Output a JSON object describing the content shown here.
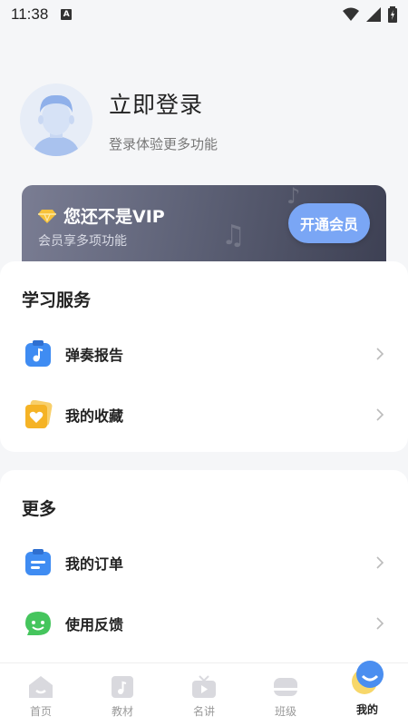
{
  "status_bar": {
    "time": "11:38",
    "indicator": "A"
  },
  "profile": {
    "title": "立即登录",
    "subtitle": "登录体验更多功能"
  },
  "vip": {
    "title": "您还不是VIP",
    "subtitle": "会员享多项功能",
    "button": "开通会员"
  },
  "study_section": {
    "title": "学习服务",
    "items": [
      {
        "label": "弹奏报告",
        "icon": "report-icon"
      },
      {
        "label": "我的收藏",
        "icon": "favorite-icon"
      }
    ]
  },
  "more_section": {
    "title": "更多",
    "items": [
      {
        "label": "我的订单",
        "icon": "order-icon"
      },
      {
        "label": "使用反馈",
        "icon": "feedback-icon"
      }
    ]
  },
  "bottom_nav": {
    "items": [
      {
        "label": "首页"
      },
      {
        "label": "教材"
      },
      {
        "label": "名讲"
      },
      {
        "label": "班级"
      },
      {
        "label": "我的"
      }
    ],
    "active_index": 4
  },
  "colors": {
    "accent": "#7aa6f5",
    "vip_bg": "#5e6277",
    "report_icon": "#3f8cf2",
    "favorite_icon": "#f5b325",
    "feedback_icon": "#45c55d"
  }
}
